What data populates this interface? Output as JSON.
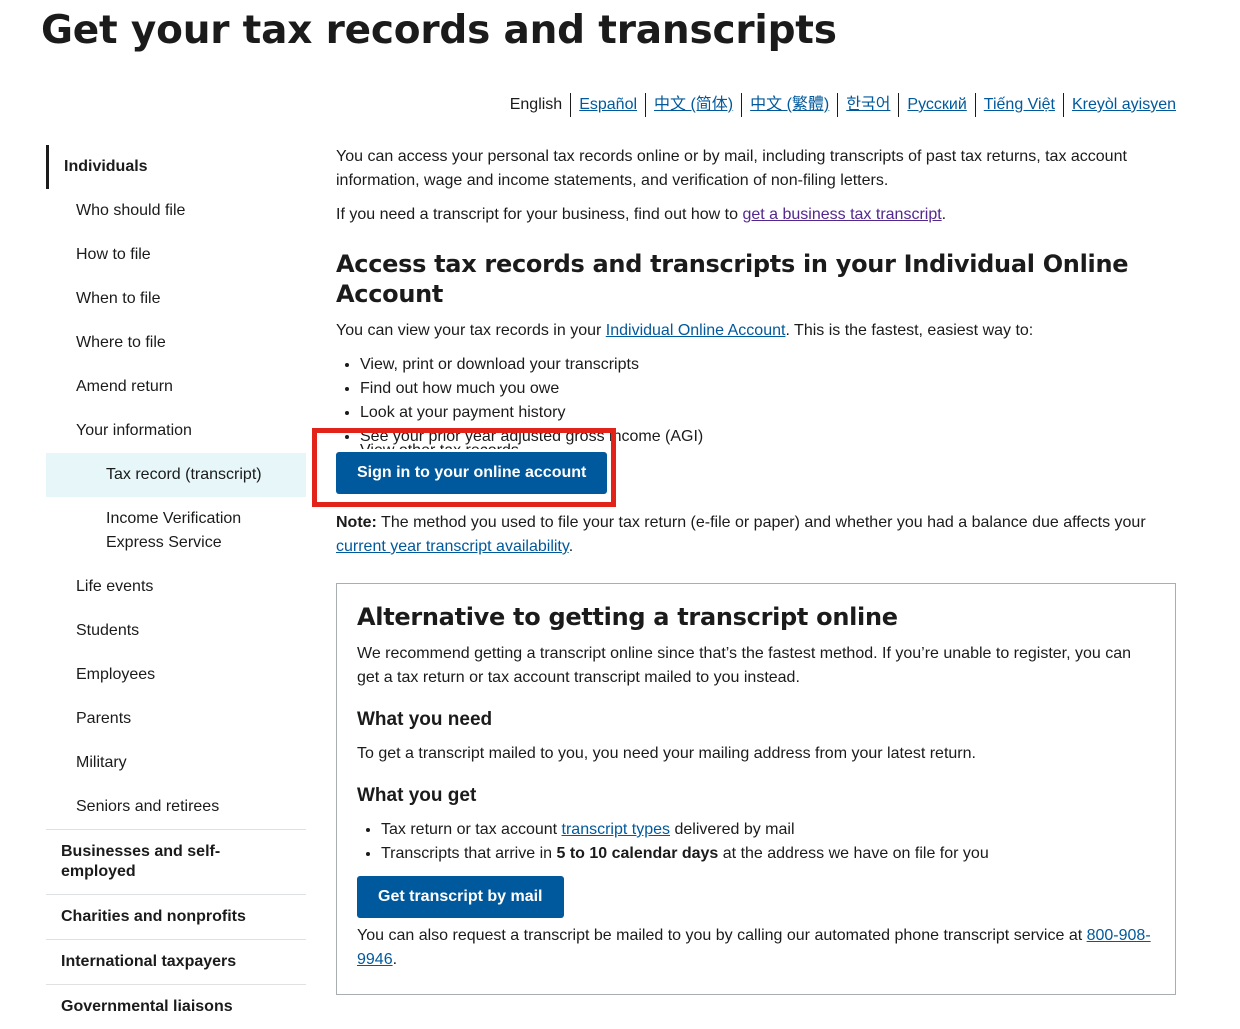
{
  "title": "Get your tax records and transcripts",
  "languages": [
    {
      "label": "English",
      "current": true
    },
    {
      "label": "Español"
    },
    {
      "label": "中文 (简体)"
    },
    {
      "label": "中文 (繁體)"
    },
    {
      "label": "한국어"
    },
    {
      "label": "Русский"
    },
    {
      "label": "Tiếng Việt"
    },
    {
      "label": "Kreyòl ayisyen"
    }
  ],
  "sidebar": {
    "heading": "Individuals",
    "items": [
      "Who should file",
      "How to file",
      "When to file",
      "Where to file",
      "Amend return",
      "Your information"
    ],
    "sub_items": [
      "Tax record (transcript)",
      "Income Verification Express Service"
    ],
    "items_after": [
      "Life events",
      "Students",
      "Employees",
      "Parents",
      "Military",
      "Seniors and retirees"
    ],
    "sections": [
      "Businesses and self-employed",
      "Charities and nonprofits",
      "International taxpayers",
      "Governmental liaisons"
    ]
  },
  "main": {
    "intro": "You can access your personal tax records online or by mail, including transcripts of past tax returns, tax account information, wage and income statements, and verification of non-filing letters.",
    "business_prefix": "If you need a transcript for your business, find out how to ",
    "business_link": "get a business tax transcript",
    "business_suffix": ".",
    "online_heading": "Access tax records and transcripts in your Individual Online Account",
    "online_prefix": "You can view your tax records in your ",
    "online_link": "Individual Online Account",
    "online_suffix": ". This is the fastest, easiest way to:",
    "online_list": [
      "View, print or download your transcripts",
      "Find out how much you owe",
      "Look at your payment history",
      "See your prior year adjusted gross income (AGI)",
      "View other tax records"
    ],
    "sign_in_button": "Sign in to your online account",
    "note_label": "Note:",
    "note_text": " The method you used to file your tax return (e-file or paper) and whether you had a balance due affects your ",
    "note_link": "current year transcript availability",
    "note_suffix": "."
  },
  "alt": {
    "heading": "Alternative to getting a transcript online",
    "intro": "We recommend getting a transcript online since that’s the fastest method. If you’re unable to register, you can get a tax return or tax account transcript mailed to you instead.",
    "need_heading": "What you need",
    "need_text": "To get a transcript mailed to you, you need your mailing address from your latest return.",
    "get_heading": "What you get",
    "get_item1_prefix": "Tax return or tax account ",
    "get_item1_link": "transcript types",
    "get_item1_suffix": " delivered by mail",
    "get_item2_prefix": "Transcripts that arrive in ",
    "get_item2_bold": "5 to 10 calendar days",
    "get_item2_suffix": " at the address we have on file for you",
    "mail_button": "Get transcript by mail",
    "phone_prefix": "You can also request a transcript be mailed to you by calling our automated phone transcript service at ",
    "phone_link": "800-908-9946",
    "phone_suffix": "."
  },
  "colors": {
    "link": "#00599c",
    "visited": "#54278f",
    "button": "#00599c",
    "highlight": "#e2231a",
    "current_bg": "#e7f6f8"
  }
}
